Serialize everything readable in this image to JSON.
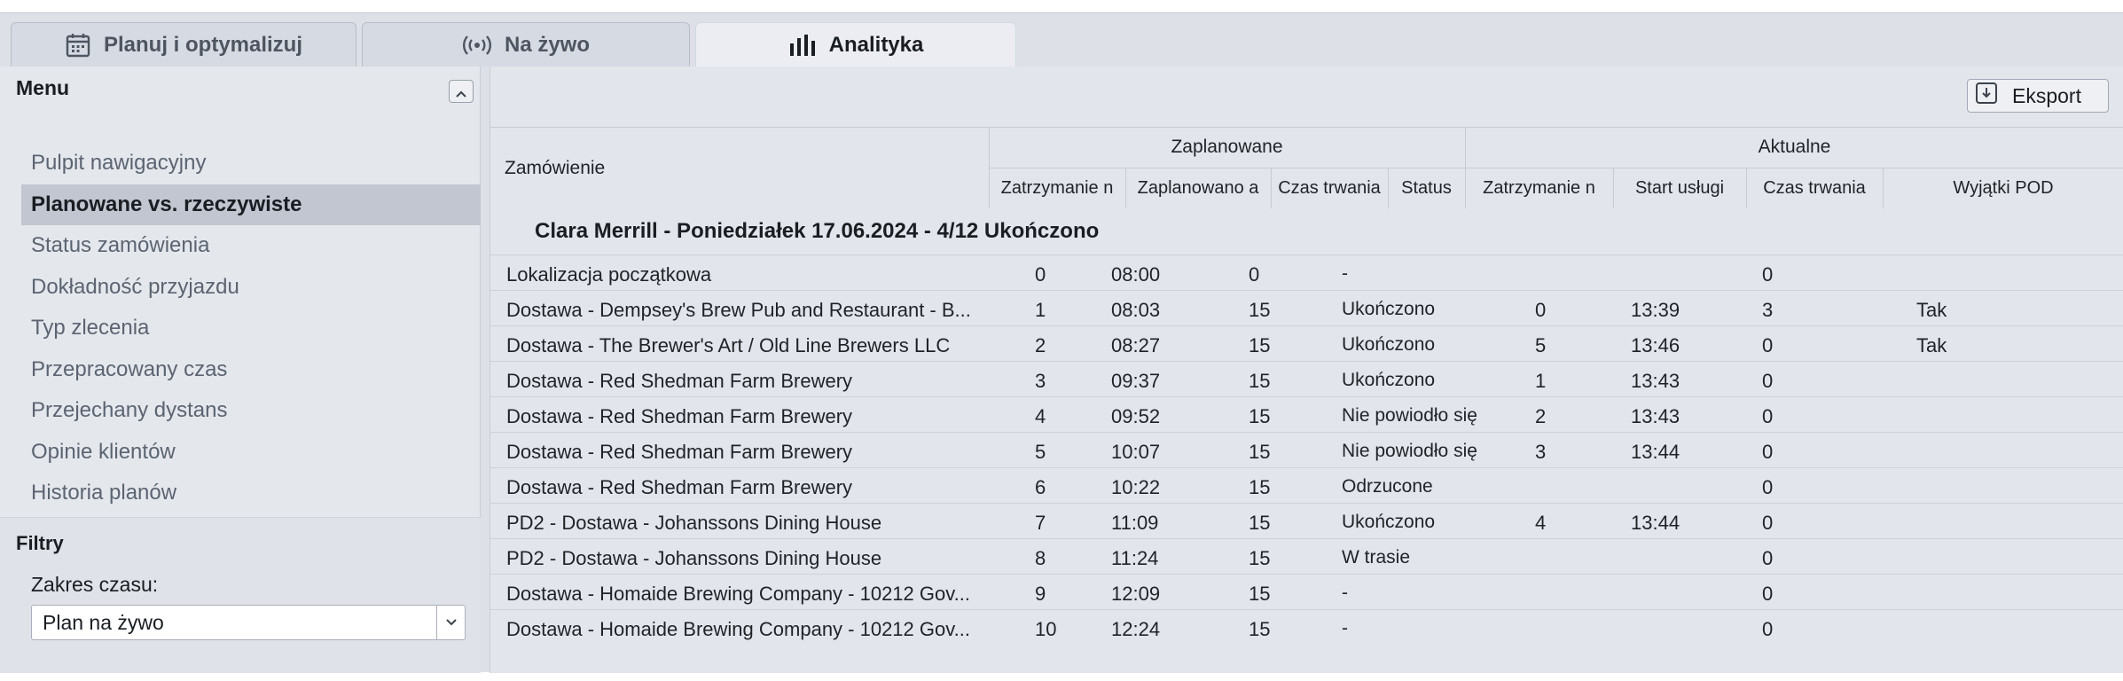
{
  "tabs": [
    {
      "label": "Planuj i optymalizuj",
      "icon": "calendar-icon"
    },
    {
      "label": "Na żywo",
      "icon": "broadcast-icon"
    },
    {
      "label": "Analityka",
      "icon": "bar-chart-icon"
    }
  ],
  "sidebar": {
    "menu_title": "Menu",
    "items": [
      {
        "label": "Pulpit nawigacyjny"
      },
      {
        "label": "Planowane vs. rzeczywiste"
      },
      {
        "label": "Status zamówienia"
      },
      {
        "label": "Dokładność przyjazdu"
      },
      {
        "label": "Typ zlecenia"
      },
      {
        "label": "Przepracowany czas"
      },
      {
        "label": "Przejechany dystans"
      },
      {
        "label": "Opinie klientów"
      },
      {
        "label": "Historia planów"
      }
    ],
    "filters_title": "Filtry",
    "time_range_label": "Zakres czasu:",
    "time_range_value": "Plan na żywo"
  },
  "main": {
    "export_label": "Eksport",
    "table": {
      "order_header": "Zamówienie",
      "planned_group": "Zaplanowane",
      "actual_group": "Aktualne",
      "planned_columns": [
        "Zatrzymanie n",
        "Zaplanowano a",
        "Czas trwania",
        "Status"
      ],
      "actual_columns": [
        "Zatrzymanie n",
        "Start usługi",
        "Czas trwania",
        "Wyjątki POD"
      ],
      "group_title": "Clara Merrill - Poniedziałek 17.06.2024 - 4/12 Ukończono",
      "rows": [
        {
          "name": "Lokalizacja początkowa",
          "p_stop": "0",
          "p_at": "08:00",
          "p_dur": "0",
          "status": "-",
          "a_stop": "",
          "a_start": "",
          "a_dur": "0",
          "pod": ""
        },
        {
          "name": "Dostawa - Dempsey's Brew Pub and Restaurant - B...",
          "p_stop": "1",
          "p_at": "08:03",
          "p_dur": "15",
          "status": "Ukończono",
          "a_stop": "0",
          "a_start": "13:39",
          "a_dur": "3",
          "pod": "Tak"
        },
        {
          "name": "Dostawa - The Brewer's Art / Old Line Brewers LLC",
          "p_stop": "2",
          "p_at": "08:27",
          "p_dur": "15",
          "status": "Ukończono",
          "a_stop": "5",
          "a_start": "13:46",
          "a_dur": "0",
          "pod": "Tak"
        },
        {
          "name": "Dostawa - Red Shedman Farm Brewery",
          "p_stop": "3",
          "p_at": "09:37",
          "p_dur": "15",
          "status": "Ukończono",
          "a_stop": "1",
          "a_start": "13:43",
          "a_dur": "0",
          "pod": ""
        },
        {
          "name": "Dostawa - Red Shedman Farm Brewery",
          "p_stop": "4",
          "p_at": "09:52",
          "p_dur": "15",
          "status": "Nie powiodło się",
          "a_stop": "2",
          "a_start": "13:43",
          "a_dur": "0",
          "pod": ""
        },
        {
          "name": "Dostawa - Red Shedman Farm Brewery",
          "p_stop": "5",
          "p_at": "10:07",
          "p_dur": "15",
          "status": "Nie powiodło się",
          "a_stop": "3",
          "a_start": "13:44",
          "a_dur": "0",
          "pod": ""
        },
        {
          "name": "Dostawa - Red Shedman Farm Brewery",
          "p_stop": "6",
          "p_at": "10:22",
          "p_dur": "15",
          "status": "Odrzucone",
          "a_stop": "",
          "a_start": "",
          "a_dur": "0",
          "pod": ""
        },
        {
          "name": "PD2 - Dostawa - Johanssons Dining House",
          "p_stop": "7",
          "p_at": "11:09",
          "p_dur": "15",
          "status": "Ukończono",
          "a_stop": "4",
          "a_start": "13:44",
          "a_dur": "0",
          "pod": ""
        },
        {
          "name": "PD2 - Dostawa - Johanssons Dining House",
          "p_stop": "8",
          "p_at": "11:24",
          "p_dur": "15",
          "status": "W trasie",
          "a_stop": "",
          "a_start": "",
          "a_dur": "0",
          "pod": ""
        },
        {
          "name": "Dostawa - Homaide Brewing Company - 10212 Gov...",
          "p_stop": "9",
          "p_at": "12:09",
          "p_dur": "15",
          "status": "-",
          "a_stop": "",
          "a_start": "",
          "a_dur": "0",
          "pod": ""
        },
        {
          "name": "Dostawa - Homaide Brewing Company - 10212 Gov...",
          "p_stop": "10",
          "p_at": "12:24",
          "p_dur": "15",
          "status": "-",
          "a_stop": "",
          "a_start": "",
          "a_dur": "0",
          "pod": ""
        }
      ]
    }
  }
}
